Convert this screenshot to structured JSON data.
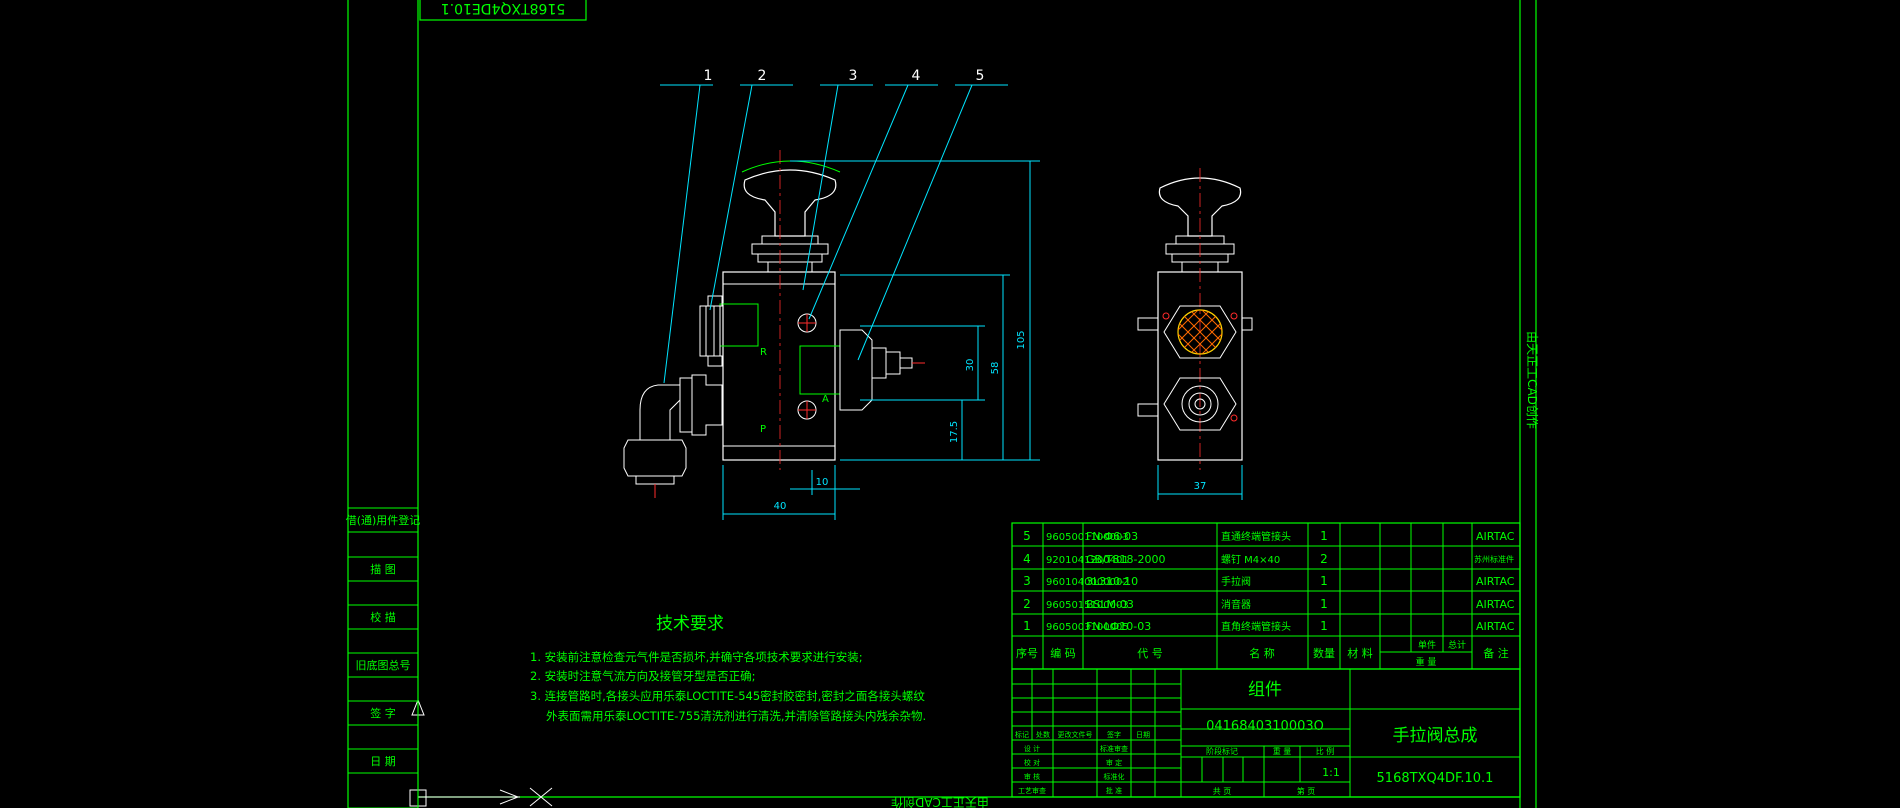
{
  "drawing": {
    "frame_stamp": "5168TXQ4DE10.1",
    "side_stamp": "由天正工CAD创作",
    "bottom_stamp": "由天正工CAD创作"
  },
  "side_panel": {
    "labels": [
      "借(通)用件登记",
      "描 图",
      "校 描",
      "旧底图总号",
      "签 字",
      "日 期"
    ]
  },
  "balloons": [
    "1",
    "2",
    "3",
    "4",
    "5"
  ],
  "port_labels": [
    "R",
    "P",
    "A"
  ],
  "dimensions": {
    "h_total": "105",
    "h_mid": "58",
    "h_port": "30",
    "h_low": "17.5",
    "w_body": "40",
    "w_port": "10",
    "w_side": "37"
  },
  "tech_requirements": {
    "title": "技术要求",
    "items": [
      "1. 安装前注意检查元气件是否损坏,并确守各项技术要求进行安装;",
      "2. 安装时注意气流方向及接管牙型是否正确;",
      "3. 连接管路时,各接头应用乐泰LOCTITE-545密封胶密封,密封之面各接头螺纹",
      "外表面需用乐泰LOCTITE-755清洗剂进行清洗,并清除管路接头内残余杂物."
    ]
  },
  "bom": {
    "rows": [
      {
        "seq": "5",
        "code": "9605001100003",
        "ref": "FN-Φ6-03",
        "name": "直通终端管接头",
        "qty": "1",
        "note": "AIRTAC"
      },
      {
        "seq": "4",
        "code": "9201041200401",
        "ref": "GB/T818-2000",
        "name": "螺钉 M4×40",
        "qty": "2",
        "note": "苏州标准件"
      },
      {
        "seq": "3",
        "code": "9601040000002",
        "ref": "3L310-10",
        "name": "手拉阀",
        "qty": "1",
        "note": "AIRTAC"
      },
      {
        "seq": "2",
        "code": "9605015100003",
        "ref": "BSLM-03",
        "name": "消音器",
        "qty": "1",
        "note": "AIRTAC"
      },
      {
        "seq": "1",
        "code": "9605003100005",
        "ref": "FN-LΦ10-03",
        "name": "直角终端管接头",
        "qty": "1",
        "note": "AIRTAC"
      }
    ],
    "header": {
      "seq": "序号",
      "code": "编 码",
      "ref": "代 号",
      "name": "名 称",
      "qty": "数量",
      "material": "材 料",
      "unit_weight": "单件",
      "total_weight": "总计",
      "weight": "重 量",
      "note": "备 注"
    }
  },
  "title_block": {
    "type": "组件",
    "drawing_no": "0416840310003O",
    "name": "手拉阀总成",
    "code": "5168TXQ4DF.10.1",
    "scale_value": "1:1",
    "labels": {
      "mark": "标记",
      "count": "处数",
      "change_doc": "更改文件号",
      "sign": "签字",
      "date": "日期",
      "design": "设 计",
      "check": "校 对",
      "review": "审 核",
      "approve": "批 准",
      "process": "工艺审查",
      "std": "标准审查",
      "audit": "审 定",
      "std2": "标准化",
      "sheet_total": "共 页",
      "sheet_no": "第 页",
      "stage": "阶段标记",
      "weight": "重 量",
      "scale": "比 例"
    }
  }
}
